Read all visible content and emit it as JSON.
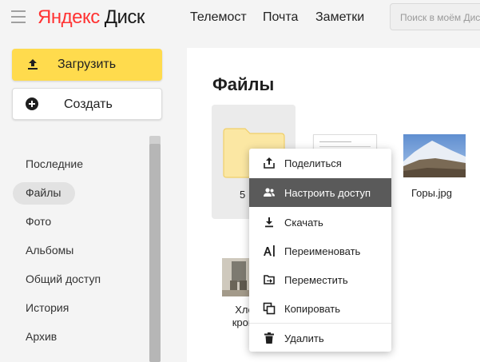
{
  "header": {
    "logo_part1": "Яндекс",
    "logo_part2": "Диск",
    "nav": [
      "Телемост",
      "Почта",
      "Заметки"
    ],
    "search_placeholder": "Поиск в моём Диске"
  },
  "sidebar": {
    "upload_label": "Загрузить",
    "create_label": "Создать",
    "items": [
      {
        "label": "Последние"
      },
      {
        "label": "Файлы",
        "active": true
      },
      {
        "label": "Фото"
      },
      {
        "label": "Альбомы"
      },
      {
        "label": "Общий доступ"
      },
      {
        "label": "История"
      },
      {
        "label": "Архив"
      }
    ]
  },
  "main": {
    "title": "Файлы",
    "files": [
      {
        "name": "5",
        "type": "folder",
        "icon": "folder-icon"
      },
      {
        "name": "",
        "type": "document",
        "icon": "document-thumbnail"
      },
      {
        "name": "Горы.jpg",
        "type": "image",
        "icon": "mountain-photo"
      },
      {
        "name_line1": "Хле",
        "name_line2": "крош",
        "type": "image",
        "icon": "person-photo"
      }
    ]
  },
  "context_menu": {
    "items": [
      {
        "label": "Поделиться",
        "icon": "share-icon"
      },
      {
        "label": "Настроить доступ",
        "icon": "people-icon",
        "active": true
      },
      {
        "label": "Скачать",
        "icon": "download-icon"
      },
      {
        "label": "Переименовать",
        "icon": "rename-icon"
      },
      {
        "label": "Переместить",
        "icon": "move-icon"
      },
      {
        "label": "Копировать",
        "icon": "copy-icon"
      },
      {
        "label": "Удалить",
        "icon": "trash-icon"
      }
    ]
  },
  "colors": {
    "accent_yellow": "#ffdb4d",
    "logo_red": "#ff3333",
    "menu_active_bg": "#5a5a5a"
  }
}
